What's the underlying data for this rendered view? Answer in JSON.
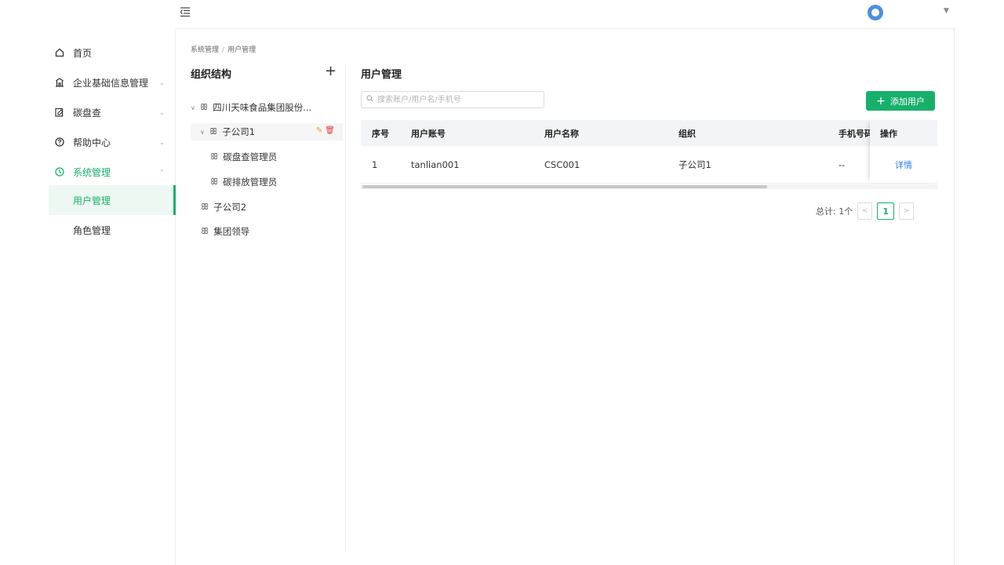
{
  "sidebar": {
    "items": [
      {
        "label": "首页",
        "icon": "home-icon"
      },
      {
        "label": "企业基础信息管理",
        "icon": "building-icon",
        "caret": "⌄"
      },
      {
        "label": "碳盘查",
        "icon": "edit-doc-icon",
        "caret": "⌄"
      },
      {
        "label": "帮助中心",
        "icon": "help-icon",
        "caret": "⌄"
      },
      {
        "label": "系统管理",
        "icon": "clock-icon",
        "caret": "⌃"
      }
    ],
    "sub_items": [
      {
        "label": "用户管理",
        "active": true
      },
      {
        "label": "角色管理",
        "active": false
      }
    ]
  },
  "breadcrumb": {
    "parent": "系统管理",
    "sep": "/",
    "current": "用户管理"
  },
  "org": {
    "title": "组织结构",
    "add": "+",
    "tree": [
      {
        "label": "四川天味食品集团股份..."
      },
      {
        "label": "子公司1"
      },
      {
        "label": "碳盘查管理员"
      },
      {
        "label": "碳排放管理员"
      },
      {
        "label": "子公司2"
      },
      {
        "label": "集团领导"
      }
    ]
  },
  "users": {
    "title": "用户管理",
    "search_placeholder": "搜索账户/用户名/手机号",
    "add_button": "添加用户",
    "columns": [
      "序号",
      "用户账号",
      "用户名称",
      "组织",
      "手机号码",
      "操作"
    ],
    "rows": [
      {
        "index": "1",
        "account": "tanlian001",
        "name": "CSC001",
        "org": "子公司1",
        "phone": "--",
        "action": "详情"
      }
    ]
  },
  "pagination": {
    "total": "总计: 1个",
    "current_page": "1",
    "prev": "<",
    "next": ">"
  },
  "colors": {
    "accent": "#17b06b",
    "link": "#2f80ed"
  }
}
